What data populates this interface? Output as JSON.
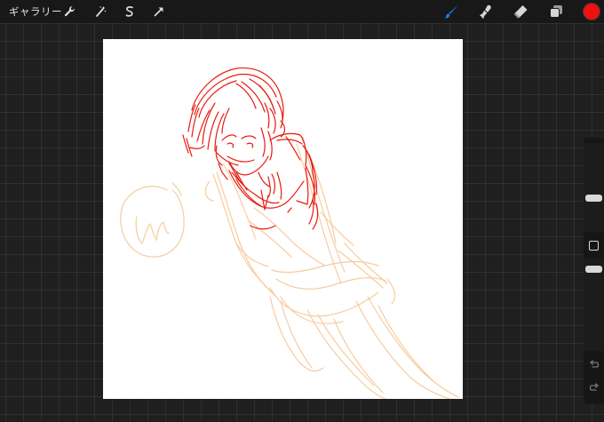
{
  "topbar": {
    "gallery_label": "ギャラリー",
    "left_tools": [
      {
        "name": "wrench-icon"
      },
      {
        "name": "magic-wand-icon"
      },
      {
        "name": "selection-s-icon"
      },
      {
        "name": "transform-arrow-icon"
      }
    ],
    "right_tools": [
      {
        "name": "brush-icon",
        "active": true,
        "color": "#1e7ef5"
      },
      {
        "name": "smudge-icon",
        "active": false,
        "color": "#d6d6d6"
      },
      {
        "name": "eraser-icon",
        "active": false,
        "color": "#d6d6d6"
      },
      {
        "name": "layers-icon",
        "active": false,
        "color": "#d6d6d6"
      }
    ],
    "current_color": "#f01010"
  },
  "sidebar": {
    "brush_size_icon": "brush-size-slider",
    "opacity_icon": "opacity-slider",
    "modifier_icon": "square-modifier-icon",
    "undo_icon": "undo-arrow-icon",
    "redo_icon": "redo-arrow-icon"
  },
  "canvas": {
    "background": "#ffffff",
    "ink_colors": {
      "primary": "#e81a10",
      "sketch": "#f8c99a",
      "signature": "#f3d2a6"
    }
  }
}
